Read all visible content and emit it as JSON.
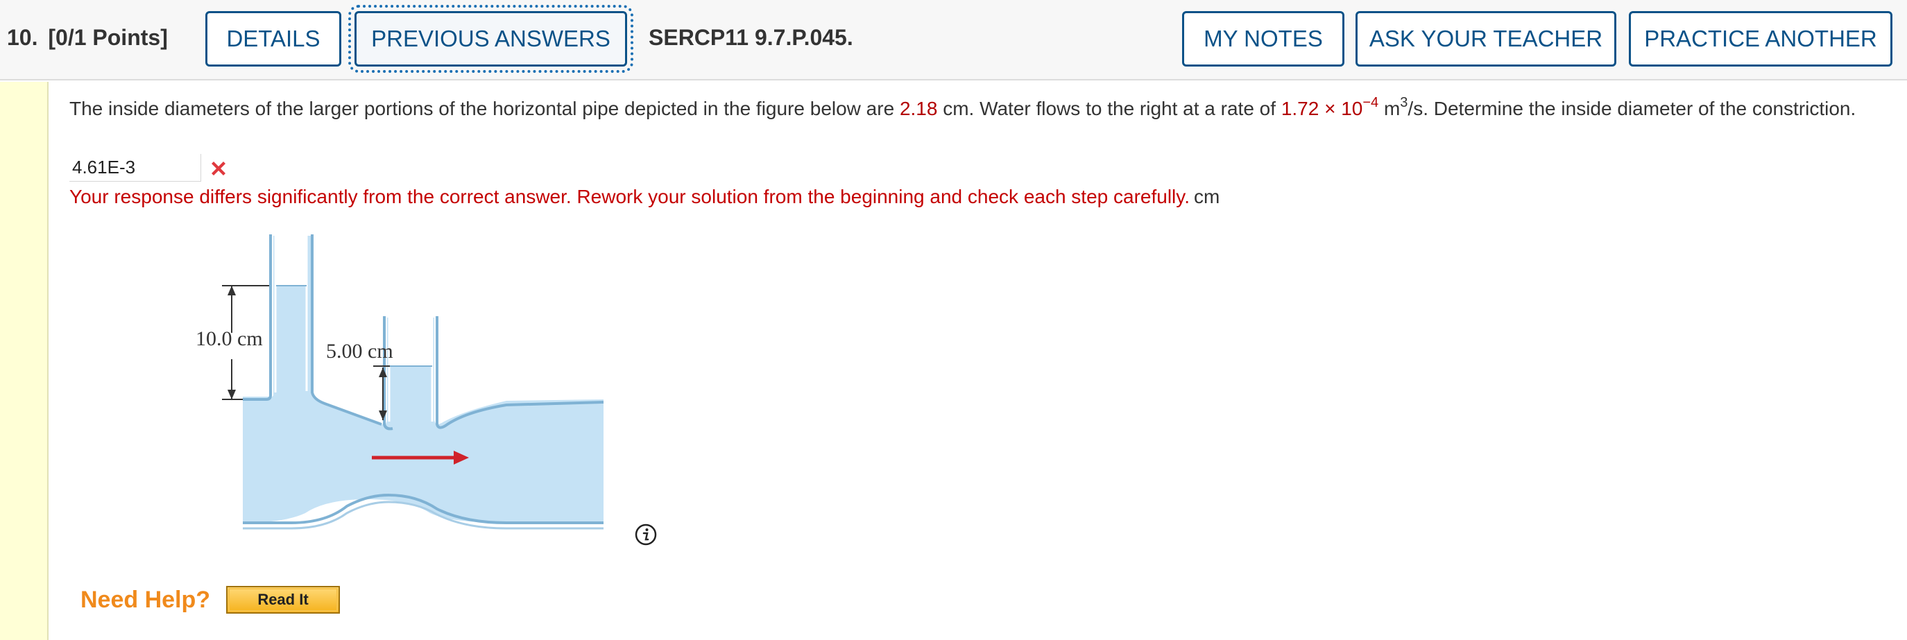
{
  "header": {
    "question_number": "10.",
    "points": "[0/1 Points]",
    "details_label": "DETAILS",
    "previous_answers_label": "PREVIOUS ANSWERS",
    "course_id": "SERCP11 9.7.P.045.",
    "my_notes_label": "MY NOTES",
    "ask_teacher_label": "ASK YOUR TEACHER",
    "practice_another_label": "PRACTICE ANOTHER"
  },
  "question": {
    "text_1": "The inside diameters of the larger portions of the horizontal pipe depicted in the figure below are ",
    "diameter_value": "2.18",
    "text_2": " cm. Water flows to the right at a rate of ",
    "rate_value": "1.72 × 10",
    "rate_exponent": "−4",
    "text_3": " m",
    "unit_exponent": "3",
    "text_4": "/s. Determine the inside diameter of the constriction."
  },
  "answer": {
    "value": "4.61E-3",
    "feedback": "Your response differs significantly from the correct answer. Rework your solution from the beginning and check each step carefully.",
    "unit": "cm"
  },
  "figure": {
    "label_left_height": "10.0 cm",
    "label_right_height": "5.00 cm"
  },
  "help": {
    "need_help_label": "Need Help?",
    "read_it_label": "Read It"
  },
  "colors": {
    "accent": "#0b5288",
    "highlight_value": "#b30000",
    "error": "#c40000",
    "water": "#c5e2f5"
  }
}
